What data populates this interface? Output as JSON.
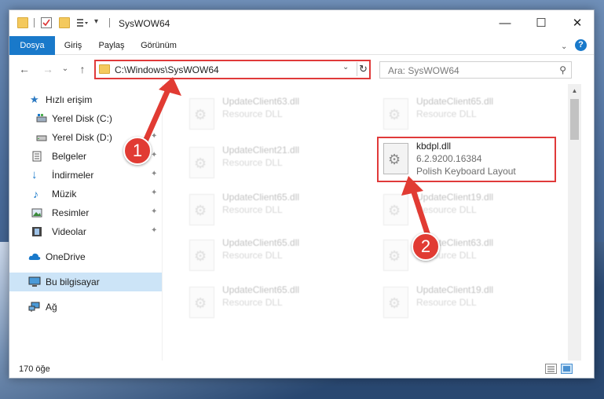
{
  "window": {
    "title": "SysWOW64"
  },
  "ribbon": {
    "tabs": [
      "Dosya",
      "Giriş",
      "Paylaş",
      "Görünüm"
    ],
    "help_label": "?"
  },
  "window_controls": {
    "minimize": "—",
    "maximize": "☐",
    "close": "✕"
  },
  "nav": {
    "back": "←",
    "forward": "→",
    "recent": "⌄",
    "up": "↑",
    "address": "C:\\Windows\\SysWOW64",
    "address_dropdown": "⌄",
    "refresh": "↻",
    "search_placeholder": "Ara: SysWOW64",
    "search_icon_glyph": "⚲"
  },
  "sidebar": {
    "items": [
      {
        "label": "Hızlı erişim",
        "icon": "star-icon",
        "pinned": false
      },
      {
        "label": "Yerel Disk (C:)",
        "icon": "drive-icon",
        "pinned": false
      },
      {
        "label": "Yerel Disk (D:)",
        "icon": "drive-icon",
        "pinned": true
      },
      {
        "label": "Belgeler",
        "icon": "documents-icon",
        "pinned": true
      },
      {
        "label": "İndirmeler",
        "icon": "download-icon",
        "pinned": true
      },
      {
        "label": "Müzik",
        "icon": "music-icon",
        "pinned": true
      },
      {
        "label": "Resimler",
        "icon": "pictures-icon",
        "pinned": true
      },
      {
        "label": "Videolar",
        "icon": "video-icon",
        "pinned": true
      },
      {
        "label": "OneDrive",
        "icon": "cloud-icon",
        "pinned": false
      },
      {
        "label": "Bu bilgisayar",
        "icon": "computer-icon",
        "pinned": false,
        "selected": true
      },
      {
        "label": "Ağ",
        "icon": "network-icon",
        "pinned": false
      }
    ],
    "pin_glyph": "📌"
  },
  "files": [
    {
      "name": "UpdateClient63.dll",
      "type": "Resource DLL",
      "faded": true
    },
    {
      "name": "UpdateClient65.dll",
      "type": "Resource DLL",
      "faded": true
    },
    {
      "name": "UpdateClient21.dll",
      "type": "Resource DLL",
      "faded": true
    },
    {
      "name": "kbdpl.dll",
      "version": "6.2.9200.16384",
      "type": "Polish Keyboard Layout",
      "faded": false,
      "highlighted": true
    },
    {
      "name": "UpdateClient65.dll",
      "type": "Resource DLL",
      "faded": true
    },
    {
      "name": "UpdateClient19.dll",
      "type": "Resource DLL",
      "faded": true
    },
    {
      "name": "UpdateClient65.dll",
      "type": "Resource DLL",
      "faded": true
    },
    {
      "name": "UpdateClient63.dll",
      "type": "Resource DLL",
      "faded": true
    },
    {
      "name": "UpdateClient65.dll",
      "type": "Resource DLL",
      "faded": true
    },
    {
      "name": "UpdateClient19.dll",
      "type": "Resource DLL",
      "faded": true
    }
  ],
  "status": {
    "item_count": "170 öğe"
  },
  "annotations": {
    "badge1": "1",
    "badge2": "2",
    "color": "#e13b33"
  },
  "colors": {
    "accent": "#1979ca",
    "highlight": "#e03a3a",
    "selected_bg": "#cce4f7"
  }
}
